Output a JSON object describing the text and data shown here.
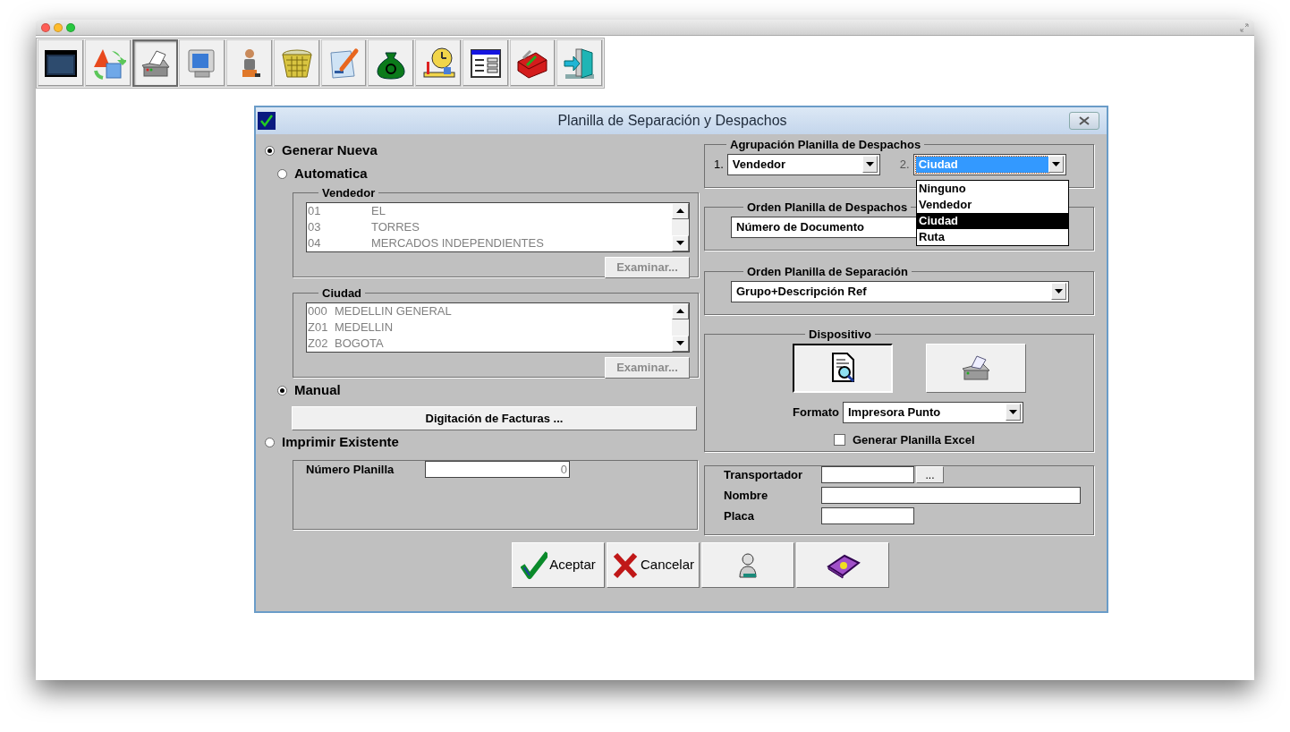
{
  "toolbar": [
    {
      "pressed": false
    },
    {
      "pressed": false
    },
    {
      "pressed": true
    },
    {
      "pressed": false
    },
    {
      "pressed": false
    },
    {
      "pressed": false
    },
    {
      "pressed": false
    },
    {
      "pressed": false
    },
    {
      "pressed": false
    },
    {
      "pressed": false
    },
    {
      "pressed": false
    },
    {
      "pressed": false
    }
  ],
  "dialog": {
    "title": "Planilla de Separación y Despachos"
  },
  "generar_nueva": {
    "label": "Generar Nueva",
    "selected": true
  },
  "automatica": {
    "label": "Automatica",
    "selected": false
  },
  "vendedor": {
    "title": "Vendedor",
    "disabled": true,
    "rows": [
      {
        "code": "01",
        "name": "EL"
      },
      {
        "code": "03",
        "name": "TORRES"
      },
      {
        "code": "04",
        "name": "MERCADOS INDEPENDIENTES"
      }
    ],
    "button": "Examinar..."
  },
  "ciudad": {
    "title": "Ciudad",
    "disabled": true,
    "rows": [
      {
        "code": "000",
        "name": "MEDELLIN GENERAL"
      },
      {
        "code": "Z01",
        "name": "MEDELLIN"
      },
      {
        "code": "Z02",
        "name": "BOGOTA"
      }
    ],
    "button": "Examinar..."
  },
  "manual": {
    "label": "Manual",
    "selected": true
  },
  "digitacion_button": "Digitación de Facturas ...",
  "imprimir_existente": {
    "label": "Imprimir Existente",
    "selected": false
  },
  "numero_planilla": {
    "label": "Número Planilla",
    "value": "0"
  },
  "agrupacion": {
    "title": "Agrupación Planilla de Despachos",
    "fields": [
      {
        "number": "1.",
        "value": "Vendedor",
        "focused": false
      },
      {
        "number": "2.",
        "value": "Ciudad",
        "focused": true
      }
    ],
    "dropdown": [
      {
        "label": "Ninguno",
        "selected": false
      },
      {
        "label": "Vendedor",
        "selected": false
      },
      {
        "label": "Ciudad",
        "selected": true
      },
      {
        "label": "Ruta",
        "selected": false
      }
    ]
  },
  "orden_despachos": {
    "title": "Orden Planilla de Despachos",
    "value": "Número de Documento"
  },
  "orden_separacion": {
    "title": "Orden Planilla de Separación",
    "value": "Grupo+Descripción Ref"
  },
  "dispositivo": {
    "title": "Dispositivo",
    "devices": [
      {
        "selected": true
      },
      {
        "selected": false
      }
    ],
    "formato_label": "Formato",
    "formato_value": "Impresora Punto",
    "excel": {
      "label": "Generar Planilla Excel",
      "checked": false
    }
  },
  "transport": [
    {
      "label": "Transportador",
      "kind": "lookup",
      "button": "..."
    },
    {
      "label": "Nombre",
      "kind": "wide"
    },
    {
      "label": "Placa",
      "kind": "short"
    }
  ],
  "action_buttons": [
    "Aceptar",
    "Cancelar"
  ]
}
